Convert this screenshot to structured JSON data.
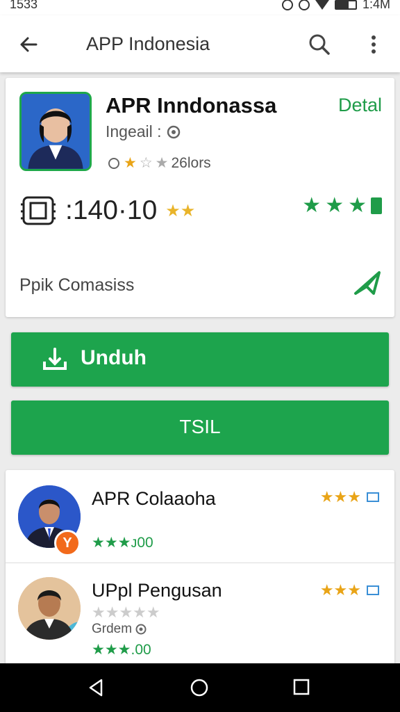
{
  "status_bar": {
    "time_left": "1533",
    "time_right": "1:4M"
  },
  "app_bar": {
    "title": "APP Indonesia"
  },
  "app_card": {
    "name": "APR Inndonassa",
    "detail_link": "Detal",
    "developer": "Ingeail :",
    "rating_text": "26lors",
    "size_value": ":140·10",
    "category": "Ppik Comasiss"
  },
  "buttons": {
    "download": "Unduh",
    "secondary": "TSIL"
  },
  "related": [
    {
      "title": "APR Colaaoha",
      "badge": "Y",
      "rating_text": "★★★ᴊ00"
    },
    {
      "title": "UPpl Pengusan",
      "developer": "Grdem",
      "rating_text": "★★★.00"
    }
  ],
  "colors": {
    "accent": "#1da44d",
    "star": "#e9a417",
    "navbar": "#000000"
  }
}
